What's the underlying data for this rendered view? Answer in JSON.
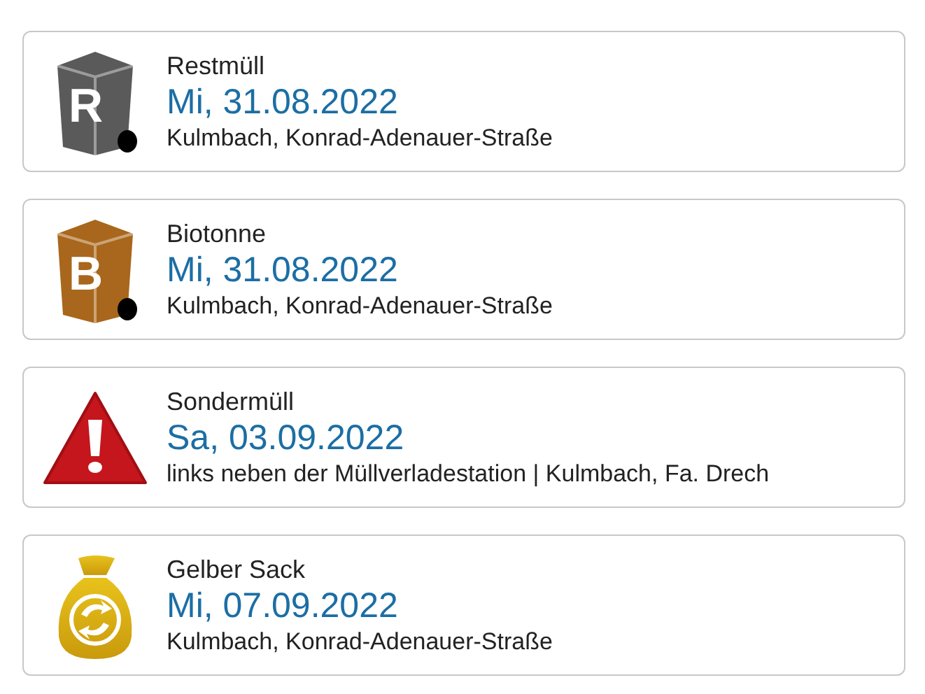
{
  "entries": [
    {
      "kind": "bin",
      "letter": "R",
      "color": "#5a5a5a",
      "type": "Restmüll",
      "date": "Mi, 31.08.2022",
      "location": "Kulmbach, Konrad-Adenauer-Straße"
    },
    {
      "kind": "bin",
      "letter": "B",
      "color": "#a8671c",
      "type": "Biotonne",
      "date": "Mi, 31.08.2022",
      "location": "Kulmbach, Konrad-Adenauer-Straße"
    },
    {
      "kind": "warning",
      "type": "Sondermüll",
      "date": "Sa, 03.09.2022",
      "location": "links neben der Müllverladestation | Kulmbach, Fa. Drech"
    },
    {
      "kind": "bag",
      "type": "Gelber Sack",
      "date": "Mi, 07.09.2022",
      "location": "Kulmbach, Konrad-Adenauer-Straße"
    }
  ]
}
